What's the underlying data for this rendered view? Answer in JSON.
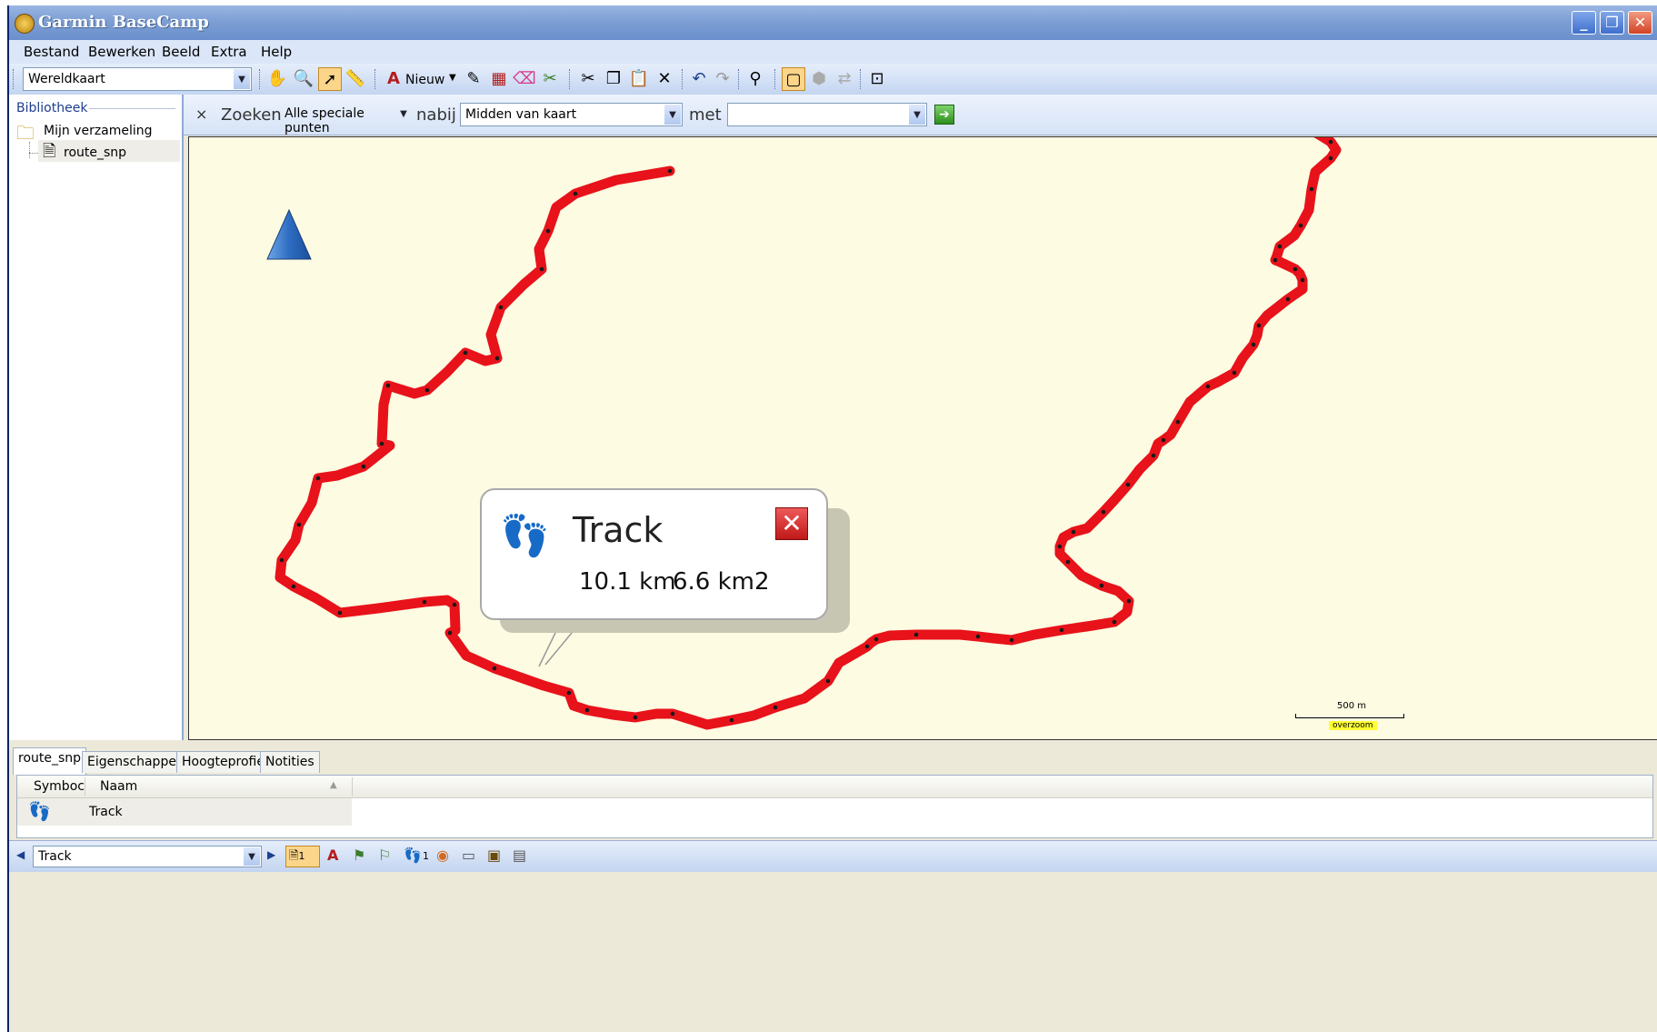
{
  "window": {
    "title": "Garmin BaseCamp",
    "controls": {
      "minimize": "_",
      "restore": "❐",
      "close": "✕"
    }
  },
  "menu": [
    "Bestand",
    "Bewerken",
    "Beeld",
    "Extra",
    "Help"
  ],
  "toolbar": {
    "map_select": "Wereldkaart",
    "new_label": "Nieuw"
  },
  "library": {
    "header": "Bibliotheek",
    "collection": "Mijn verzameling",
    "item": "route_snp"
  },
  "search": {
    "clear": "×",
    "label": "Zoeken",
    "category": "Alle speciale punten",
    "near_label": "nabij",
    "near_value": "Midden van kaart",
    "with_label": "met",
    "with_value": ""
  },
  "callout": {
    "title": "Track",
    "distance": "10.1 km",
    "area": "6.6 km2",
    "close": "✕"
  },
  "scale": {
    "distance": "500 m",
    "zoom_note": "overzoom"
  },
  "tabs": [
    "route_snp",
    "Eigenschappen",
    "Hoogteprofiel",
    "Notities"
  ],
  "list": {
    "columns": [
      "Symboc",
      "Naam"
    ],
    "rows": [
      {
        "name": "Track"
      }
    ]
  },
  "status": {
    "current": "Track",
    "waypoint_count": "1",
    "track_count": "1"
  },
  "colors": {
    "track": "#e8121a",
    "track_dots": "#1a1a1a",
    "map_bg": "#fdfbe2",
    "titlebar": "#7d9fd4",
    "close_btn": "#d24325"
  },
  "icons": {
    "hand": "hand-icon",
    "zoom": "magnifier-icon",
    "select": "arrow-select-icon",
    "measure": "ruler-icon",
    "north": "north-arrow-icon",
    "footprints": "footprints-icon"
  }
}
